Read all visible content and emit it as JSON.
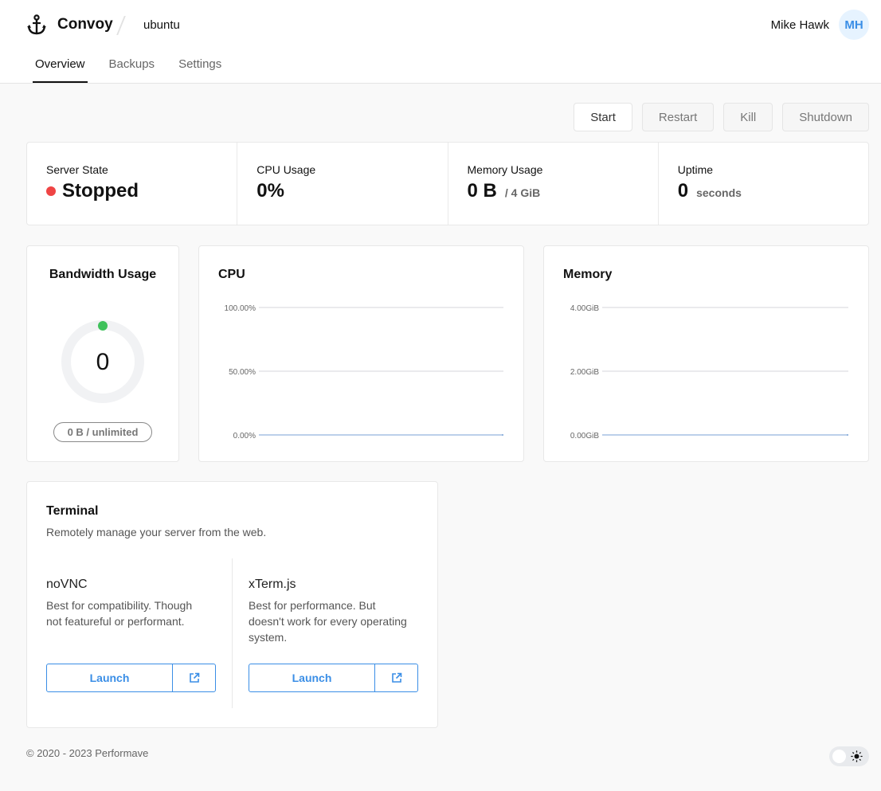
{
  "header": {
    "brand": "Convoy",
    "server": "ubuntu",
    "user_name": "Mike Hawk",
    "user_initials": "MH"
  },
  "tabs": [
    {
      "label": "Overview",
      "active": true
    },
    {
      "label": "Backups",
      "active": false
    },
    {
      "label": "Settings",
      "active": false
    }
  ],
  "actions": {
    "start": "Start",
    "restart": "Restart",
    "kill": "Kill",
    "shutdown": "Shutdown"
  },
  "stats": {
    "server_state": {
      "label": "Server State",
      "value": "Stopped",
      "status_color": "#ef4444"
    },
    "cpu": {
      "label": "CPU Usage",
      "value": "0%"
    },
    "memory": {
      "label": "Memory Usage",
      "value": "0 B",
      "suffix": "/ 4 GiB"
    },
    "uptime": {
      "label": "Uptime",
      "value": "0",
      "suffix": "seconds"
    }
  },
  "bandwidth": {
    "title": "Bandwidth Usage",
    "value": "0",
    "usage_fraction": 0,
    "pill": "0 B / unlimited"
  },
  "chart_data": [
    {
      "type": "line",
      "title": "CPU",
      "ylim": [
        0,
        100
      ],
      "yticks": [
        "0.00%",
        "50.00%",
        "100.00%"
      ],
      "ytick_values": [
        0,
        50,
        100
      ],
      "series": [
        {
          "name": "CPU",
          "values": [
            0,
            0
          ],
          "color": "#7aa2d6"
        }
      ],
      "grid": true
    },
    {
      "type": "line",
      "title": "Memory",
      "ylim": [
        0,
        4
      ],
      "yticks": [
        "0.00GiB",
        "2.00GiB",
        "4.00GiB"
      ],
      "ytick_values": [
        0,
        2,
        4
      ],
      "series": [
        {
          "name": "Memory",
          "values": [
            0,
            0
          ],
          "color": "#7aa2d6"
        }
      ],
      "grid": true
    }
  ],
  "terminal": {
    "title": "Terminal",
    "description": "Remotely manage your server from the web.",
    "options": [
      {
        "name": "noVNC",
        "description": "Best for compatibility. Though not featureful or performant.",
        "button": "Launch"
      },
      {
        "name": "xTerm.js",
        "description": "Best for performance. But doesn't work for every operating system.",
        "button": "Launch"
      }
    ]
  },
  "footer": {
    "copyright": "© 2020 - 2023 Performave"
  },
  "colors": {
    "accent": "#3a8ee6",
    "online": "#3fc15b",
    "stopped": "#ef4444"
  }
}
